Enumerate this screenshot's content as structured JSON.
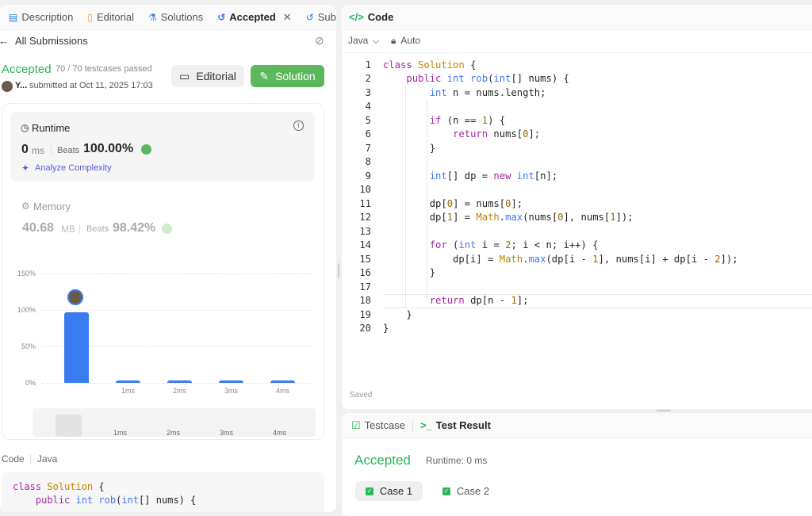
{
  "left_tabs": [
    {
      "label": "Description",
      "icon": "description-icon"
    },
    {
      "label": "Editorial",
      "icon": "book-icon"
    },
    {
      "label": "Solutions",
      "icon": "flask-icon"
    },
    {
      "label": "Accepted",
      "icon": "history-icon"
    },
    {
      "label": "Subm",
      "icon": "history-icon"
    }
  ],
  "nav": {
    "back": "All Submissions"
  },
  "submission": {
    "status": "Accepted",
    "tests": "70 / 70 testcases passed",
    "user": "Y...",
    "submitted": "submitted at Oct 11, 2025 17:03"
  },
  "buttons": {
    "editorial": "Editorial",
    "solution": "Solution"
  },
  "runtime": {
    "title": "Runtime",
    "value": "0",
    "unit": "ms",
    "beats_label": "Beats",
    "beats": "100.00%",
    "analyze": "Analyze Complexity"
  },
  "memory": {
    "title": "Memory",
    "value": "40.68",
    "unit": "MB",
    "beats_label": "Beats",
    "beats": "98.42%"
  },
  "chart_data": {
    "type": "bar",
    "categories": [
      "",
      "1ms",
      "2ms",
      "3ms",
      "4ms"
    ],
    "values": [
      97,
      3,
      3,
      3,
      3
    ],
    "y_ticks": [
      "150%",
      "100%",
      "50%",
      "0%"
    ],
    "ylim": [
      0,
      150
    ],
    "mini_labels": [
      "1ms",
      "2ms",
      "3ms",
      "4ms"
    ],
    "accent": "#3a7bf0"
  },
  "bottom_code": {
    "title": "Code",
    "lang": "Java",
    "line1": "class Solution {",
    "line2": "    public int rob(int[] nums) {"
  },
  "editor": {
    "title": "Code",
    "lang": "Java",
    "mode": "Auto",
    "status": "Saved",
    "lines": [
      "1",
      "2",
      "3",
      "4",
      "5",
      "6",
      "7",
      "8",
      "9",
      "10",
      "11",
      "12",
      "13",
      "14",
      "15",
      "16",
      "17",
      "18",
      "19",
      "20"
    ]
  },
  "result": {
    "tab1": "Testcase",
    "tab2": "Test Result",
    "status": "Accepted",
    "runtime": "Runtime: 0 ms",
    "case1": "Case 1",
    "case2": "Case 2"
  },
  "colors": {
    "accepted": "#2db55d",
    "button_green": "#5cb85c",
    "link": "#5b5bd6"
  }
}
